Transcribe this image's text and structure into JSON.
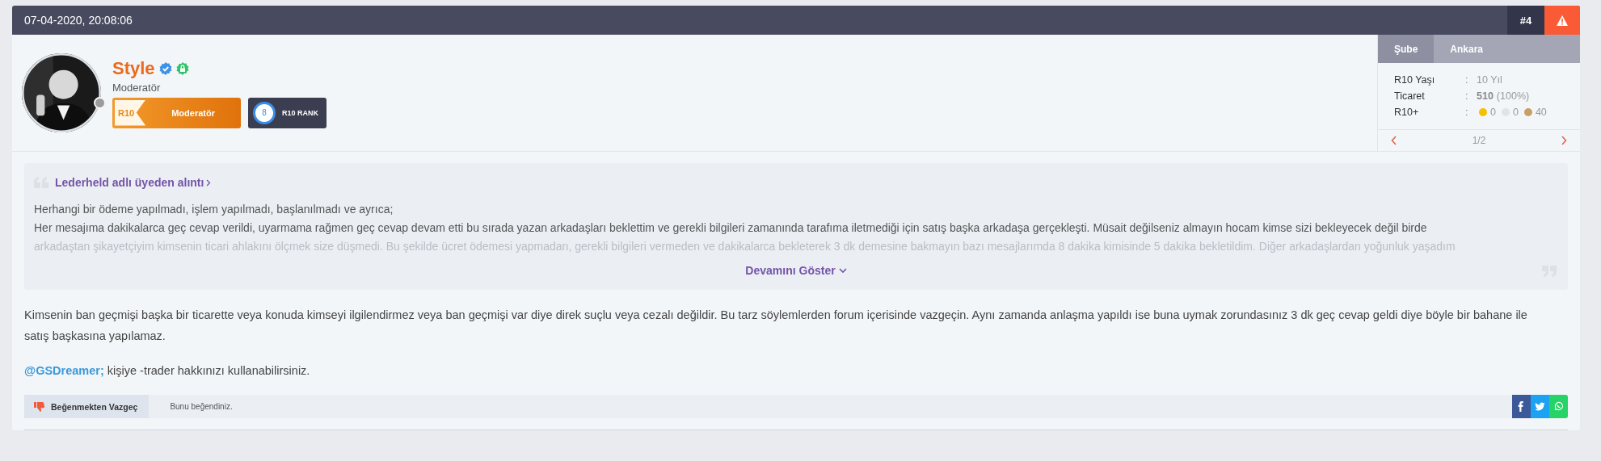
{
  "post": {
    "date": "07-04-2020, 20:08:06",
    "number": "#4"
  },
  "author": {
    "name": "Style",
    "title": "Moderatör",
    "online": false,
    "badge": {
      "prefix": "R10",
      "label": "Moderatör"
    },
    "rank": {
      "level": "8",
      "label": "R10 RANK"
    }
  },
  "info_panel": {
    "tabs": [
      {
        "label": "Şube",
        "selected": true
      },
      {
        "label": "Ankara",
        "selected": false
      }
    ],
    "stats": [
      {
        "label": "R10 Yaşı",
        "sep": ":",
        "kind": "plain",
        "value": "10 Yıl"
      },
      {
        "label": "Ticaret",
        "sep": ":",
        "kind": "trade",
        "value": "510",
        "extra": "(100%)"
      },
      {
        "label": "R10+",
        "sep": ":",
        "kind": "medals",
        "medals": [
          {
            "color": "#f5c000",
            "count": "0"
          },
          {
            "color": "#e1e3e8",
            "count": "0"
          },
          {
            "color": "#c9a064",
            "count": "40"
          }
        ]
      }
    ],
    "pager": "1/2"
  },
  "quote": {
    "source": "Lederheld adlı üyeden alıntı",
    "lines": [
      "Herhangi bir ödeme yapılmadı, işlem yapılmadı, başlanılmadı ve ayrıca;",
      "Her mesajıma dakikalarca geç cevap verildi, uyarmama rağmen geç cevap devam etti bu sırada yazan arkadaşları beklettim ve gerekli bilgileri zamanında tarafıma iletmediği için satış başka arkadaşa gerçekleşti. Müsait değilseniz almayın hocam kimse sizi bekleyecek değil birde",
      "arkadaştan şikayetçiyim kimsenin ticari ahlakını ölçmek size düşmedi. Bu şekilde ücret ödemesi yapmadan, gerekli bilgileri vermeden ve dakikalarca bekleterek 3 dk demesine bakmayın bazı mesajlarımda 8 dakika kimisinde 5 dakika bekletildim. Diğer arkadaşlardan yoğunluk yaşadım"
    ],
    "expand": "Devamını Göster"
  },
  "body": {
    "paragraph": "Kimsenin ban geçmişi başka bir ticarette veya konuda kimseyi ilgilendirmez veya ban geçmişi var diye direk suçlu veya cezalı değildir. Bu tarz söylemlerden forum içerisinde vazgeçin. Aynı zamanda anlaşma yapıldı ise buna uymak zorundasınız 3 dk geç cevap geldi diye böyle bir bahane ile satış başkasına yapılamaz.",
    "mention": "@GSDreamer;",
    "mention_text": "kişiye -trader hakkınızı kullanabilirsiniz."
  },
  "footer": {
    "like_button": "Beğenmekten Vazgeç",
    "liked": true,
    "like_status": "Bunu beğendiniz.",
    "share": [
      {
        "kind": "facebook"
      },
      {
        "kind": "twitter"
      },
      {
        "kind": "whatsapp"
      }
    ]
  }
}
